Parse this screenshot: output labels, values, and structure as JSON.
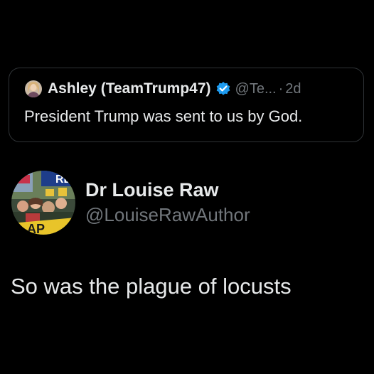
{
  "quoted_post": {
    "author_name": "Ashley (TeamTrump47)",
    "handle": "@Te...",
    "separator": "·",
    "time": "2d",
    "text": "President Trump was sent to us by God.",
    "verified_color": "#1d9bf0"
  },
  "post": {
    "author_name": "Dr Louise Raw",
    "handle": "@LouiseRawAuthor",
    "text": "So was the plague of locusts"
  },
  "colors": {
    "background": "#000000",
    "primary_text": "#e7e9ea",
    "secondary_text": "#71767b",
    "border": "#2f3336"
  }
}
